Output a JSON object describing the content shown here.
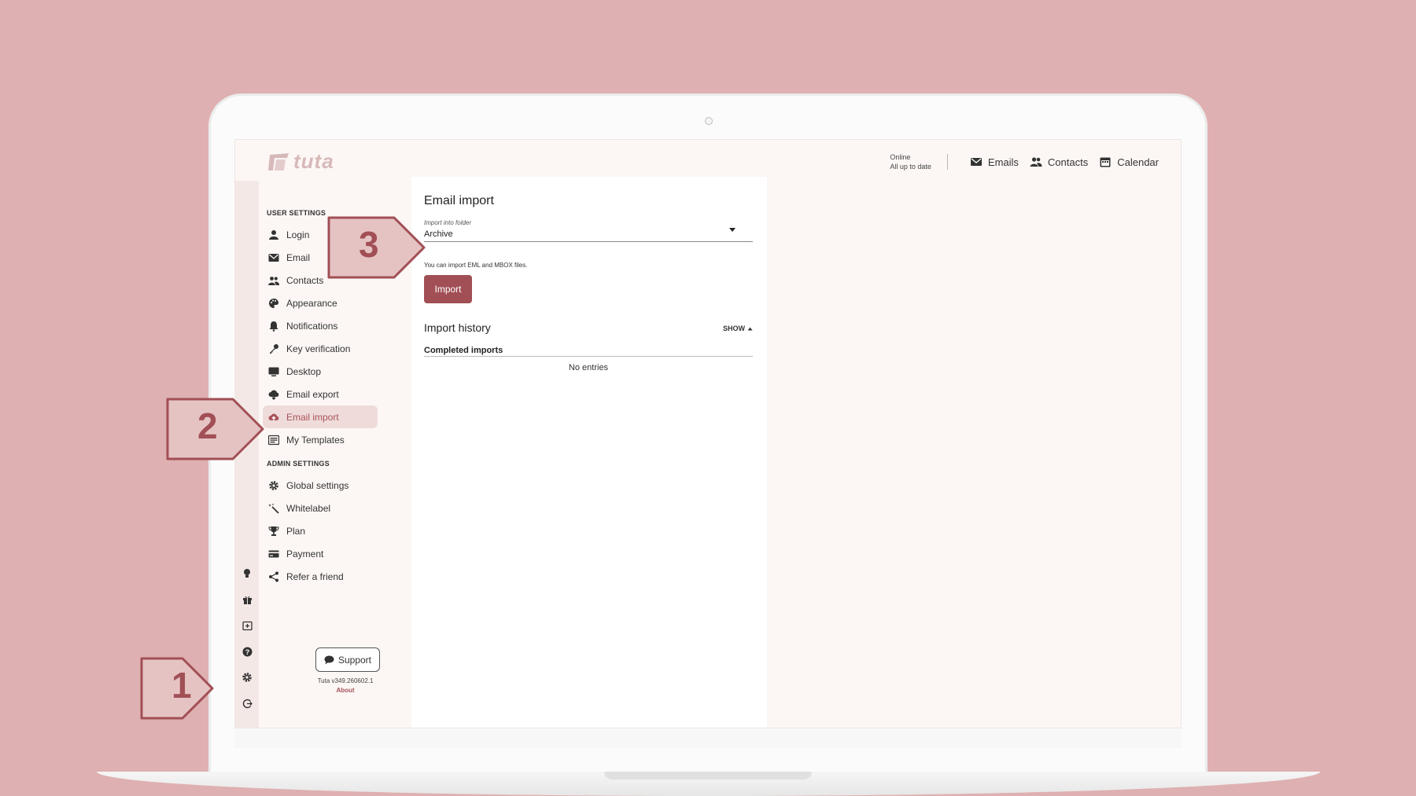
{
  "app": {
    "name": "tuta"
  },
  "top_nav": {
    "status_line1": "Online",
    "status_line2": "All up to date",
    "items": [
      {
        "label": "Emails",
        "icon": "mail-icon"
      },
      {
        "label": "Contacts",
        "icon": "people-icon"
      },
      {
        "label": "Calendar",
        "icon": "calendar-icon"
      }
    ]
  },
  "sidebar": {
    "user_settings_title": "USER SETTINGS",
    "user_items": [
      {
        "label": "Login",
        "icon": "person-icon"
      },
      {
        "label": "Email",
        "icon": "mail-icon"
      },
      {
        "label": "Contacts",
        "icon": "people-icon"
      },
      {
        "label": "Appearance",
        "icon": "palette-icon"
      },
      {
        "label": "Notifications",
        "icon": "bell-icon"
      },
      {
        "label": "Key verification",
        "icon": "key-icon"
      },
      {
        "label": "Desktop",
        "icon": "monitor-icon"
      },
      {
        "label": "Email export",
        "icon": "cloud-download-icon"
      },
      {
        "label": "Email import",
        "icon": "cloud-upload-icon",
        "active": true
      },
      {
        "label": "My Templates",
        "icon": "template-icon"
      }
    ],
    "admin_settings_title": "ADMIN SETTINGS",
    "admin_items": [
      {
        "label": "Global settings",
        "icon": "gear-icon"
      },
      {
        "label": "Whitelabel",
        "icon": "wand-icon"
      },
      {
        "label": "Plan",
        "icon": "trophy-icon"
      },
      {
        "label": "Payment",
        "icon": "credit-card-icon"
      },
      {
        "label": "Refer a friend",
        "icon": "share-icon"
      }
    ],
    "support_label": "Support",
    "version": "Tuta v349.260602.1",
    "about": "About"
  },
  "main": {
    "title": "Email import",
    "folder_label": "Import into folder",
    "folder_value": "Archive",
    "hint": "You can import EML and MBOX files.",
    "import_button": "Import",
    "history_title": "Import history",
    "show_label": "SHOW",
    "completed_title": "Completed imports",
    "no_entries": "No entries"
  },
  "callouts": [
    "1",
    "2",
    "3"
  ],
  "colors": {
    "accent": "#a14f55",
    "background": "#dfb0b1",
    "active_bg": "#efdcda"
  }
}
